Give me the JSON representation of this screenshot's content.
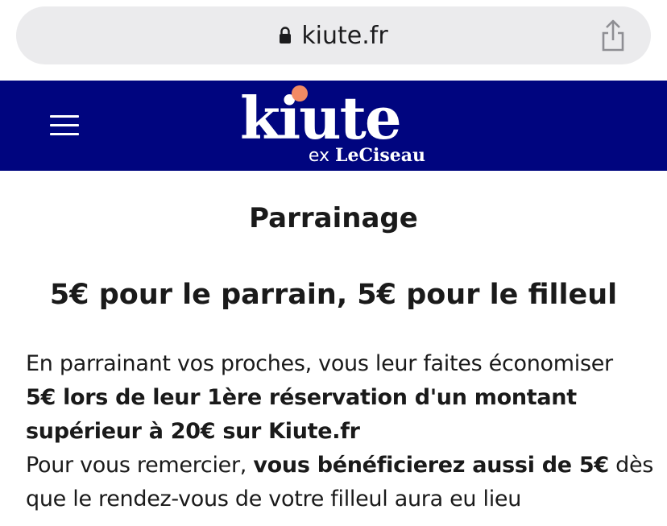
{
  "browser": {
    "url": "kiute.fr"
  },
  "header": {
    "logo_text": "kiute",
    "logo_sub_prefix": "ex",
    "logo_sub_brand": "LeCiseau"
  },
  "page": {
    "title": "Parrainage",
    "subtitle": "5€ pour le parrain, 5€ pour le filleul",
    "intro": "En parrainant vos proches, vous leur faites économiser",
    "offer": "5€ lors de leur 1ère réservation d'un montant supérieur à 20€ sur Kiute.fr",
    "thanks": "Pour vous remercier,",
    "reward": "vous bénéficierez aussi de 5€",
    "condition": "dès que le rendez-vous de votre filleul aura eu lieu"
  },
  "colors": {
    "header_bg": "#00057f",
    "logo_dot": "#f28a64",
    "url_bar": "#ebebed"
  }
}
